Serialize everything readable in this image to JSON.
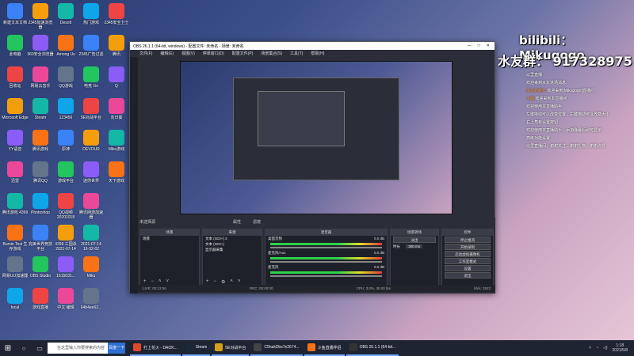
{
  "desktop": {
    "icons_col1": [
      "新建文本文档",
      "此电脑",
      "回收站",
      "Microsoft Edge",
      "YY语音",
      "迅雷",
      "腾讯游戏 4399",
      "Bumin Test 生存游戏",
      "网易UU加速器",
      "local"
    ],
    "icons_col2": [
      "2345加速浏览器",
      "360安全浏览器",
      "网易云音乐",
      "Steam",
      "腾讯游戏",
      "腾讯QQ",
      "Photoshop",
      "完美世界竞技平台",
      "OBS Studio",
      "游戏直播"
    ],
    "icons_col3": [
      "Desolt",
      "Among Us",
      "QQ游戏",
      "123456",
      "原神",
      "游戏平台",
      "QQ视频 20201018",
      "4399 三国杀 2021-07-14",
      "1615631...",
      "中文 编辑"
    ],
    "icons_col4": [
      "热门游戏",
      "2345广告过滤",
      "电竞 Go",
      "5E对战平台",
      "DEVOUR",
      "迷你世界",
      "腾讯网游加速器",
      "2021-07-14 16-32-02",
      "Miku",
      "64b4ee62..."
    ],
    "icons_col5": [
      "2345安全卫士",
      "腾讯",
      "Q",
      "向日葵",
      "Miku游戏",
      "天下游戏"
    ]
  },
  "overlay": {
    "bilibili": "bilibili：  Mikugogo",
    "group": "水友群：  917328975"
  },
  "chat": {
    "header": "以里直播",
    "lines": [
      {
        "text": "欢迎来到水友进场消息"
      },
      {
        "tag": "永远的舰长",
        "text": "欢迎来到[Mikugogo]直播间"
      },
      {
        "tag": "小鹿",
        "text": "欢迎来到本直播间"
      },
      {
        "text": "欢迎使用本直播助手"
      },
      {
        "text": "左键拖动可以改变位置，右键拖动可以改变大小"
      },
      {
        "text": "右上角有设置按钮"
      },
      {
        "text": "欢迎使用本直播助手，添加弹幕后即可显示"
      },
      {
        "text": "高级功能设置"
      },
      {
        "text": "以里直播间，谢谢关注，谢谢礼物，谢谢点赞"
      }
    ]
  },
  "obs": {
    "title": "OBS 26.1.1 (64-bit, windows) - 配置文件: 未命名 - 场景: 未命名",
    "window_controls": [
      "—",
      "□",
      "✕"
    ],
    "menu": [
      "文件(F)",
      "编辑(E)",
      "视图(V)",
      "停靠窗口(D)",
      "配置文件(P)",
      "场景集合(S)",
      "工具(T)",
      "帮助(H)"
    ],
    "no_source_label": "未选择源",
    "props_label": "属性",
    "filters_label": "滤镜",
    "docks": {
      "scenes": {
        "title": "场景",
        "items": [
          "场景"
        ]
      },
      "sources": {
        "title": "来源",
        "items": [
          "文本 (GDI+) 2",
          "文本 (GDI+)",
          "显示器采集"
        ]
      },
      "mixer": {
        "title": "混音器",
        "tracks": [
          {
            "name": "桌面音频",
            "db": "0.0 dB"
          },
          {
            "name": "麦克风/Aux",
            "db": "0.0 dB"
          },
          {
            "name": "麦克风",
            "db": "0.0 dB"
          }
        ]
      },
      "transitions": {
        "title": "场景转场",
        "type": "淡出",
        "duration_label": "时长",
        "duration": "300 ms"
      },
      "controls": {
        "title": "控件",
        "buttons": [
          "停止推流",
          "开始录制",
          "启动虚拟摄像机",
          "工作室模式",
          "设置",
          "退出"
        ]
      }
    },
    "status": {
      "live": "LIVE: 00:12:56",
      "rec": "REC: 00:00:00",
      "cpu": "CPU: 3.0%, 30.00 fps",
      "bitrate": "kb/s: 2522"
    }
  },
  "taskbar": {
    "search_placeholder": "在这里输入你要搜索的内容",
    "search_button": "百度一下",
    "tasks": [
      {
        "label": "打上花火 - DAOK..."
      },
      {
        "label": "Steam"
      },
      {
        "label": "5E对战平台"
      },
      {
        "label": "C5hakDbs7e2674..."
      },
      {
        "label": "斗鱼直播伴侣"
      },
      {
        "label": "OBS 26.1.1 (64-bit..."
      }
    ],
    "time": "1:18",
    "date": "2021/5/8"
  },
  "colors": {
    "accent": "#2f6fd1",
    "obs_bg": "#2b2e38",
    "meter_green": "#2bd14b",
    "meter_red": "#e03b3b"
  }
}
